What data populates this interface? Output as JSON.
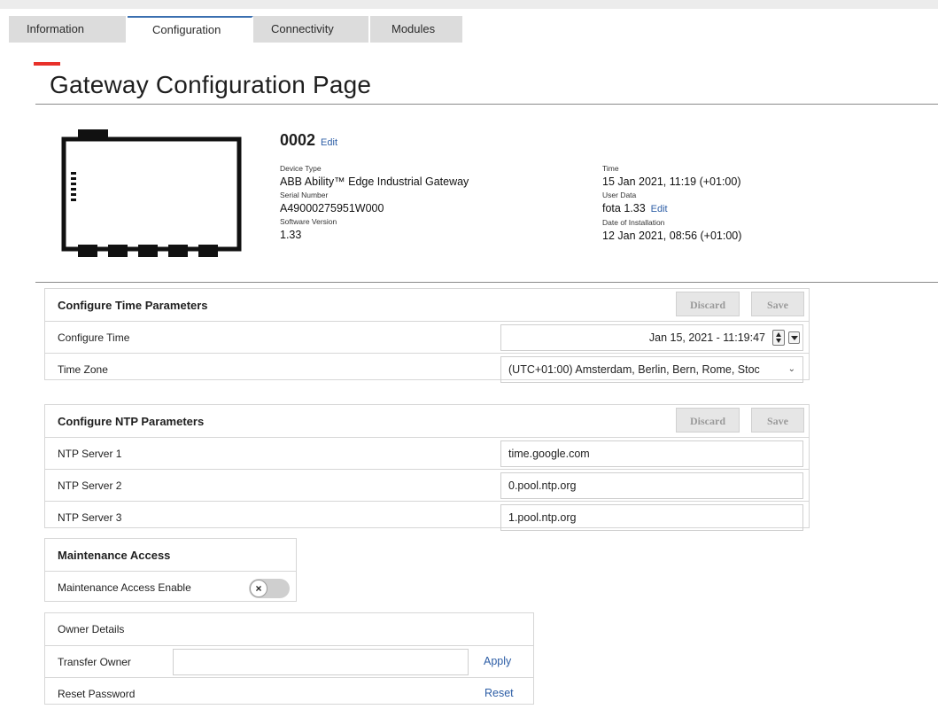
{
  "tabs": [
    "Information",
    "Configuration",
    "Connectivity",
    "Modules"
  ],
  "active_tab": "Configuration",
  "page_title": "Gateway Configuration Page",
  "device": {
    "name": "0002",
    "edit_label": "Edit",
    "device_type_label": "Device Type",
    "device_type": "ABB Ability™ Edge Industrial Gateway",
    "serial_label": "Serial Number",
    "serial": "A49000275951W000",
    "software_label": "Software Version",
    "software": "1.33",
    "time_label": "Time",
    "time": "15 Jan 2021, 11:19 (+01:00)",
    "user_data_label": "User Data",
    "user_data": "fota 1.33",
    "user_data_edit": "Edit",
    "install_label": "Date of Installation",
    "install": "12 Jan 2021, 08:56 (+01:00)"
  },
  "time_params": {
    "header": "Configure Time Parameters",
    "discard": "Discard",
    "save": "Save",
    "configure_time_label": "Configure Time",
    "configure_time_value": "Jan 15, 2021 - 11:19:47",
    "time_zone_label": "Time Zone",
    "time_zone_value": "(UTC+01:00) Amsterdam, Berlin, Bern, Rome, Stoc"
  },
  "ntp_params": {
    "header": "Configure NTP Parameters",
    "discard": "Discard",
    "save": "Save",
    "servers": [
      {
        "label": "NTP Server 1",
        "value": "time.google.com"
      },
      {
        "label": "NTP Server 2",
        "value": "0.pool.ntp.org"
      },
      {
        "label": "NTP Server 3",
        "value": "1.pool.ntp.org"
      }
    ]
  },
  "maintenance": {
    "header": "Maintenance Access",
    "enable_label": "Maintenance Access Enable",
    "toggle_glyph": "×",
    "enabled": false
  },
  "owner": {
    "header": "Owner Details",
    "transfer_label": "Transfer Owner",
    "transfer_value": "",
    "apply": "Apply",
    "reset_label": "Reset Password",
    "reset": "Reset"
  },
  "colors": {
    "accent_red": "#e8312a",
    "link_blue": "#2d5ea6",
    "tab_inactive": "#dcdcdc"
  }
}
